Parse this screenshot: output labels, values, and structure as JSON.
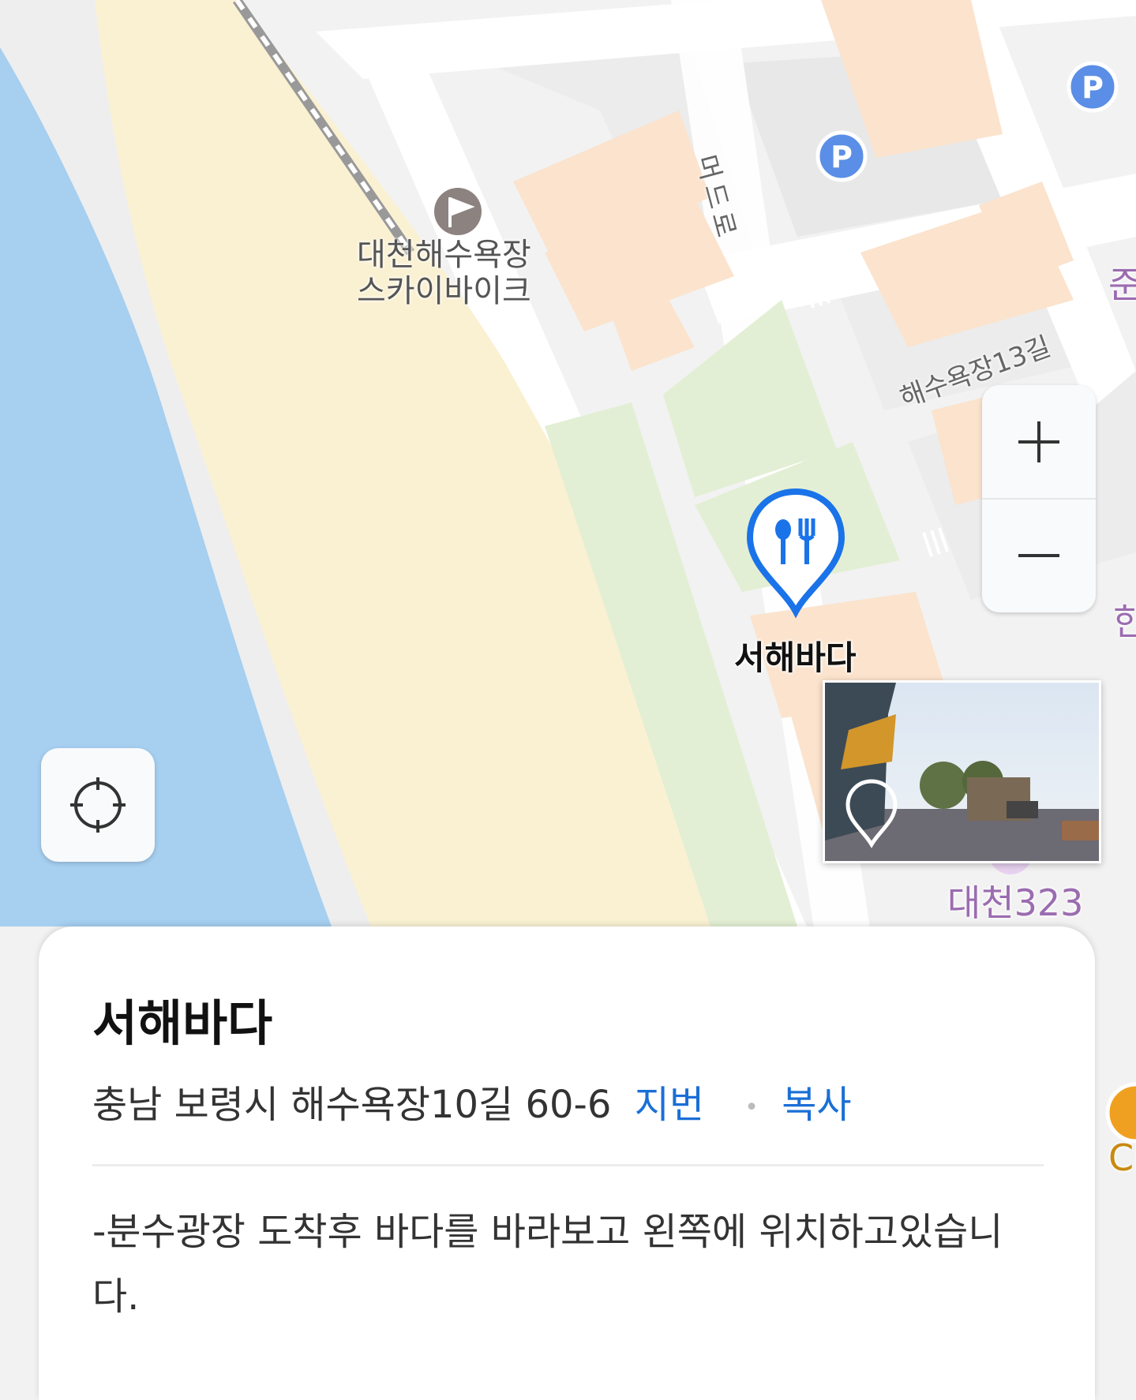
{
  "map": {
    "labels": {
      "skybike": "대천해수욕장\n스카이바이크",
      "road_meodeu": "머드로",
      "road_13gil": "해수욕장13길",
      "daecheon323": "대천323",
      "partial_right_1": "준",
      "partial_right_2": "한",
      "partial_right_3": "CI"
    },
    "parking_label": "P",
    "selected_pin": {
      "label": "서해바다",
      "icon": "restaurant-pin-icon",
      "color": "#1a73e8"
    }
  },
  "controls": {
    "zoom_in": "zoom-in-icon",
    "zoom_out": "zoom-out-icon",
    "locate": "crosshair-icon"
  },
  "place": {
    "name": "서해바다",
    "address": "충남 보령시 해수욕장10길 60-6",
    "jibun_link": "지번",
    "copy_link": "복사",
    "description": "-분수광장 도착후 바다를 바라보고 왼쪽에 위치하고있습니다."
  },
  "colors": {
    "sea": "#a6cff0",
    "sand": "#faf1d2",
    "park": "#e3efd4",
    "building": "#fbe3cd",
    "link_blue": "#1a6fd6"
  }
}
